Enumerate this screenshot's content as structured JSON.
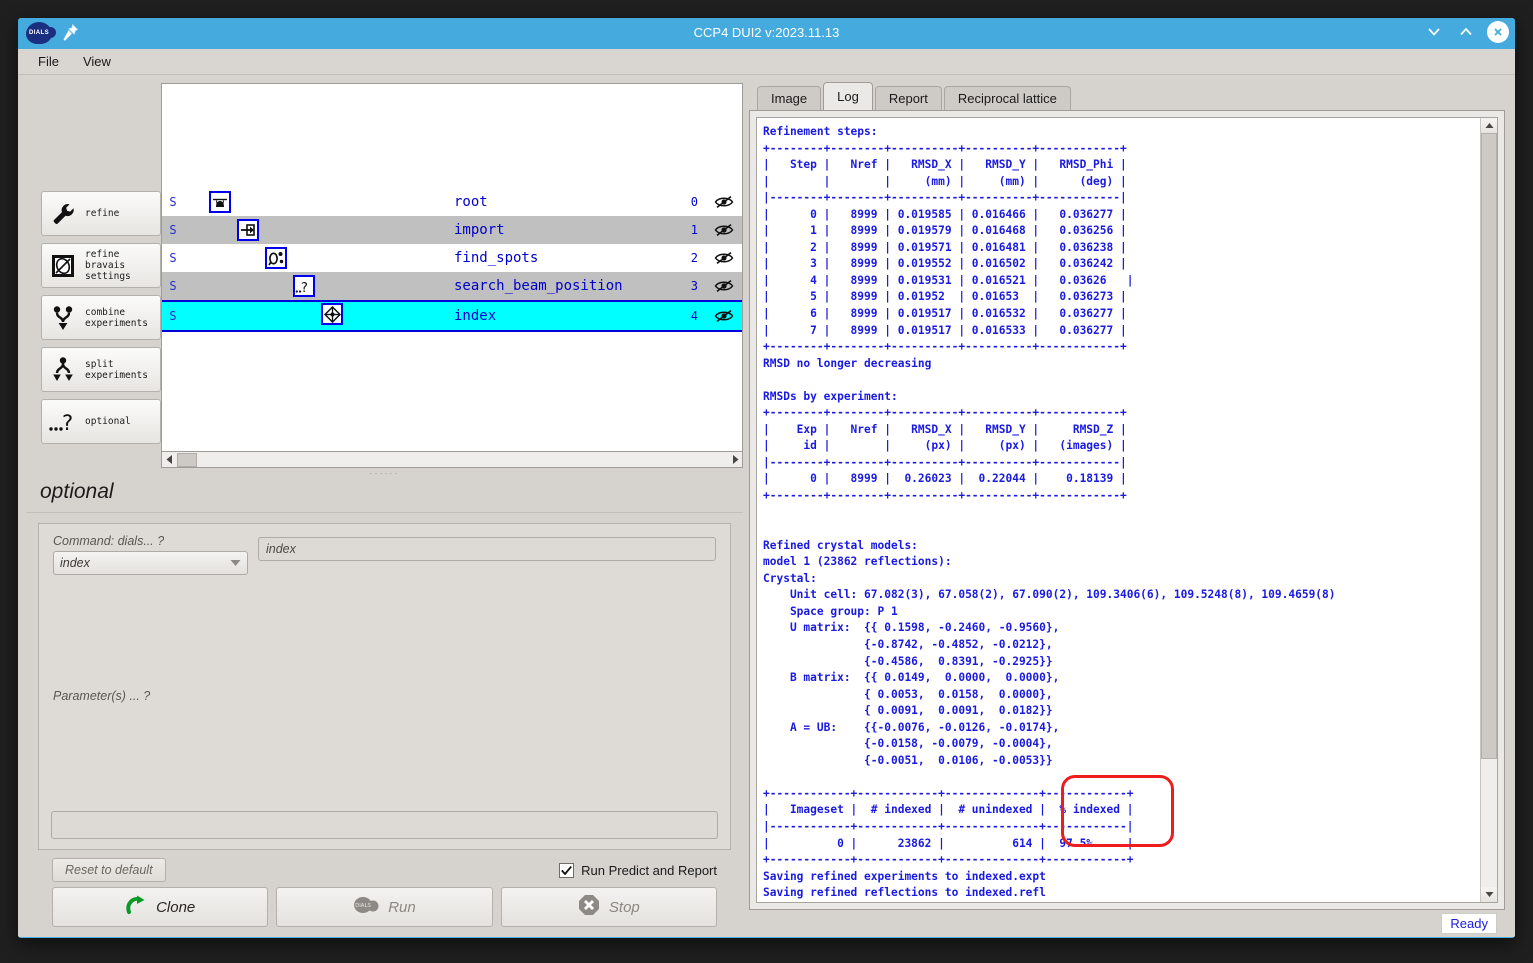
{
  "window": {
    "title": "CCP4 DUI2 v:2023.11.13",
    "logo_text": "DIALS",
    "controls": {
      "minimize": "chevron-down",
      "maximize": "chevron-up",
      "close": "close"
    }
  },
  "menubar": {
    "items": [
      "File",
      "View"
    ]
  },
  "sidebar": {
    "buttons": [
      {
        "label": "refine",
        "icon": "wrench-icon"
      },
      {
        "label": "refine\nbravais\nsettings",
        "icon": "bravais-icon"
      },
      {
        "label": "combine\nexperiments",
        "icon": "combine-icon"
      },
      {
        "label": "split\nexperiments",
        "icon": "split-icon"
      },
      {
        "label": "optional",
        "icon": "question-icon"
      }
    ]
  },
  "tree": {
    "status_letter": "S",
    "rows": [
      {
        "name": "root",
        "index": "0",
        "icon": "root-icon",
        "selected": false
      },
      {
        "name": "import",
        "index": "1",
        "icon": "import-icon",
        "selected": false
      },
      {
        "name": "find_spots",
        "index": "2",
        "icon": "find-spots-icon",
        "selected": false
      },
      {
        "name": "search_beam_position",
        "index": "3",
        "icon": "search-beam-icon",
        "selected": false
      },
      {
        "name": "index",
        "index": "4",
        "icon": "index-icon",
        "selected": true
      }
    ]
  },
  "command_panel": {
    "title": "optional",
    "command_label": "Command:  dials...  ?",
    "command_select_value": "index",
    "command_input_value": "index",
    "parameters_label": "Parameter(s) ... ?",
    "parameters_input_value": "",
    "reset_label": "Reset to default",
    "checkbox_label": "Run Predict and Report",
    "checkbox_checked": true,
    "buttons": [
      {
        "label": "Clone",
        "icon": "clone-arrow-icon",
        "disabled": false
      },
      {
        "label": "Run",
        "icon": "dials-logo-icon",
        "disabled": true
      },
      {
        "label": "Stop",
        "icon": "stop-octagon-icon",
        "disabled": true
      }
    ]
  },
  "tabs": {
    "items": [
      "Image",
      "Log",
      "Report",
      "Reciprocal lattice"
    ],
    "active": "Log"
  },
  "log": {
    "text": "Refinement steps:\n+--------+--------+----------+----------+------------+\n|   Step |   Nref |   RMSD_X |   RMSD_Y |   RMSD_Phi |\n|        |        |     (mm) |     (mm) |      (deg) |\n|--------+--------+----------+----------+------------|\n|      0 |   8999 | 0.019585 | 0.016466 |   0.036277 |\n|      1 |   8999 | 0.019579 | 0.016468 |   0.036256 |\n|      2 |   8999 | 0.019571 | 0.016481 |   0.036238 |\n|      3 |   8999 | 0.019552 | 0.016502 |   0.036242 |\n|      4 |   8999 | 0.019531 | 0.016521 |   0.03626   |\n|      5 |   8999 | 0.01952  | 0.01653  |   0.036273 |\n|      6 |   8999 | 0.019517 | 0.016532 |   0.036277 |\n|      7 |   8999 | 0.019517 | 0.016533 |   0.036277 |\n+--------+--------+----------+----------+------------+\nRMSD no longer decreasing\n\nRMSDs by experiment:\n+--------+--------+----------+----------+------------+\n|    Exp |   Nref |   RMSD_X |   RMSD_Y |     RMSD_Z |\n|     id |        |     (px) |     (px) |   (images) |\n|--------+--------+----------+----------+------------|\n|      0 |   8999 |  0.26023 |  0.22044 |    0.18139 |\n+--------+--------+----------+----------+------------+\n\n\nRefined crystal models:\nmodel 1 (23862 reflections):\nCrystal:\n    Unit cell: 67.082(3), 67.058(2), 67.090(2), 109.3406(6), 109.5248(8), 109.4659(8)\n    Space group: P 1\n    U matrix:  {{ 0.1598, -0.2460, -0.9560},\n               {-0.8742, -0.4852, -0.0212},\n               {-0.4586,  0.8391, -0.2925}}\n    B matrix:  {{ 0.0149,  0.0000,  0.0000},\n               { 0.0053,  0.0158,  0.0000},\n               { 0.0091,  0.0091,  0.0182}}\n    A = UB:    {{-0.0076, -0.0126, -0.0174},\n               {-0.0158, -0.0079, -0.0004},\n               {-0.0051,  0.0106, -0.0053}}\n\n+------------+------------+--------------+------------+\n|   Imageset |  # indexed |  # unindexed |  % indexed |\n|------------+------------+--------------+------------|\n|          0 |      23862 |          614 |  97.5%     |\n+------------+------------+--------------+------------+\nSaving refined experiments to indexed.expt\nSaving refined reflections to indexed.refl",
    "annotation": {
      "color": "#ee1c1c",
      "target": "% indexed column",
      "value": "97.5%"
    }
  },
  "statusbar": {
    "status": "Ready"
  },
  "colors": {
    "titlebar": "#45abdf",
    "log_text": "#1a1ae0",
    "selection": "#00ffff",
    "annotation": "#ee1c1c",
    "panel": "#d6d3ce"
  }
}
